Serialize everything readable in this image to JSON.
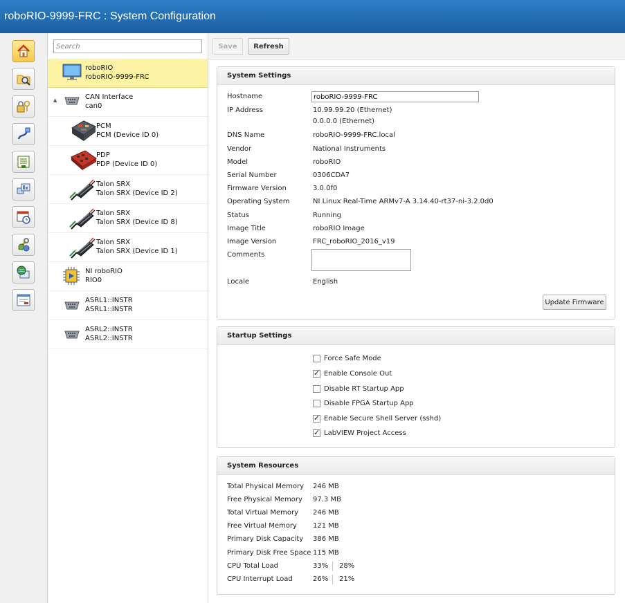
{
  "window": {
    "title": "roboRIO-9999-FRC : System Configuration"
  },
  "rail": {
    "items": [
      {
        "name": "home",
        "icon": "home-icon",
        "active": true
      },
      {
        "name": "find",
        "icon": "folder-search-icon"
      },
      {
        "name": "security",
        "icon": "lock-icon"
      },
      {
        "name": "network",
        "icon": "cable-icon"
      },
      {
        "name": "console",
        "icon": "console-icon"
      },
      {
        "name": "monitor",
        "icon": "monitor-icon"
      },
      {
        "name": "schedule",
        "icon": "clock-window-icon"
      },
      {
        "name": "software",
        "icon": "tools-icon"
      },
      {
        "name": "web-server",
        "icon": "globe-pc-icon"
      },
      {
        "name": "settings",
        "icon": "settings-window-icon"
      }
    ]
  },
  "search": {
    "placeholder": "Search",
    "value": ""
  },
  "tree": [
    {
      "title": "roboRIO",
      "subtitle": "roboRIO-9999-FRC",
      "icon": "monitor-icon",
      "selected": true
    },
    {
      "title": "CAN Interface",
      "subtitle": "can0",
      "icon": "serial-port-icon",
      "expander": "▲"
    },
    {
      "title": "PCM",
      "subtitle": "PCM (Device ID 0)",
      "icon": "pcm-module-icon"
    },
    {
      "title": "PDP",
      "subtitle": "PDP (Device ID 0)",
      "icon": "pdp-board-icon"
    },
    {
      "title": "Talon SRX",
      "subtitle": "Talon SRX (Device ID 2)",
      "icon": "talon-srx-icon"
    },
    {
      "title": "Talon SRX",
      "subtitle": "Talon SRX (Device ID 8)",
      "icon": "talon-srx-icon"
    },
    {
      "title": "Talon SRX",
      "subtitle": "Talon SRX (Device ID 1)",
      "icon": "talon-srx-icon"
    },
    {
      "title": "NI roboRIO",
      "subtitle": "RIO0",
      "icon": "chip-icon"
    },
    {
      "title": "ASRL1::INSTR",
      "subtitle": "ASRL1::INSTR",
      "icon": "serial-port-icon"
    },
    {
      "title": "ASRL2::INSTR",
      "subtitle": "ASRL2::INSTR",
      "icon": "serial-port-icon"
    }
  ],
  "toolbar": {
    "save_label": "Save",
    "refresh_label": "Refresh"
  },
  "system_settings": {
    "heading": "System Settings",
    "hostname_label": "Hostname",
    "hostname_value": "roboRIO-9999-FRC",
    "ip_label": "IP Address",
    "ip_value_1": "10.99.99.20 (Ethernet)",
    "ip_value_2": "0.0.0.0 (Ethernet)",
    "dns_label": "DNS Name",
    "dns_value": "roboRIO-9999-FRC.local",
    "vendor_label": "Vendor",
    "vendor_value": "National Instruments",
    "model_label": "Model",
    "model_value": "roboRIO",
    "serial_label": "Serial Number",
    "serial_value": "0306CDA7",
    "firmware_label": "Firmware Version",
    "firmware_value": "3.0.0f0",
    "os_label": "Operating System",
    "os_value": "NI Linux Real-Time ARMv7-A 3.14.40-rt37-ni-3.2.0d0",
    "status_label": "Status",
    "status_value": "Running",
    "image_title_label": "Image Title",
    "image_title_value": "roboRIO Image",
    "image_version_label": "Image Version",
    "image_version_value": "FRC_roboRIO_2016_v19",
    "comments_label": "Comments",
    "comments_value": "",
    "locale_label": "Locale",
    "locale_value": "English",
    "update_firmware_label": "Update Firmware"
  },
  "startup_settings": {
    "heading": "Startup Settings",
    "options": [
      {
        "label": "Force Safe Mode",
        "checked": false
      },
      {
        "label": "Enable Console Out",
        "checked": true
      },
      {
        "label": "Disable RT Startup App",
        "checked": false
      },
      {
        "label": "Disable FPGA Startup App",
        "checked": false
      },
      {
        "label": "Enable Secure Shell Server (sshd)",
        "checked": true
      },
      {
        "label": "LabVIEW Project Access",
        "checked": true
      }
    ]
  },
  "system_resources": {
    "heading": "System Resources",
    "rows": [
      {
        "label": "Total Physical Memory",
        "value": "246 MB"
      },
      {
        "label": "Free Physical Memory",
        "value": "97.3 MB"
      },
      {
        "label": "Total Virtual Memory",
        "value": "246 MB"
      },
      {
        "label": "Free Virtual Memory",
        "value": "121 MB"
      },
      {
        "label": "Primary Disk Capacity",
        "value": "386 MB"
      },
      {
        "label": "Primary Disk Free Space",
        "value": "115 MB"
      }
    ],
    "cpu_total_label": "CPU Total Load",
    "cpu_total_1": "33%",
    "cpu_total_2": "28%",
    "cpu_interrupt_label": "CPU Interrupt Load",
    "cpu_interrupt_1": "26%",
    "cpu_interrupt_2": "21%"
  }
}
